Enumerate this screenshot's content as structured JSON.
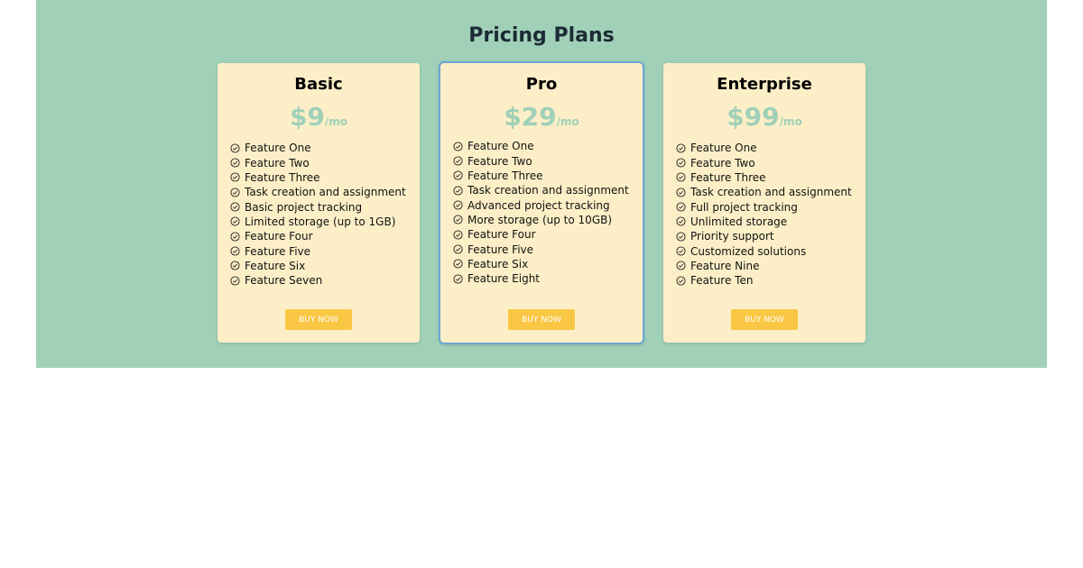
{
  "title": "Pricing Plans",
  "colors": {
    "section_bg": "#a1d0b8",
    "card_bg": "#fcefc7",
    "price": "#a1d0b8",
    "button": "#f9c744",
    "featured_border": "#6aa6d6",
    "title": "#1c2b35"
  },
  "plans": [
    {
      "name": "Basic",
      "price": "$9",
      "period": "/mo",
      "button": "BUY NOW",
      "features": [
        "Feature One",
        "Feature Two",
        "Feature Three",
        "Task creation and assignment",
        "Basic project tracking",
        "Limited storage (up to 1GB)",
        "Feature Four",
        "Feature Five",
        "Feature Six",
        "Feature Seven"
      ]
    },
    {
      "name": "Pro",
      "price": "$29",
      "period": "/mo",
      "button": "BUY NOW",
      "featured": true,
      "features": [
        "Feature One",
        "Feature Two",
        "Feature Three",
        "Task creation and assignment",
        "Advanced project tracking",
        "More storage (up to 10GB)",
        "Feature Four",
        "Feature Five",
        "Feature Six",
        "Feature Eight"
      ]
    },
    {
      "name": "Enterprise",
      "price": "$99",
      "period": "/mo",
      "button": "BUY NOW",
      "features": [
        "Feature One",
        "Feature Two",
        "Feature Three",
        "Task creation and assignment",
        "Full project tracking",
        "Unlimited storage",
        "Priority support",
        "Customized solutions",
        "Feature Nine",
        "Feature Ten"
      ]
    }
  ],
  "icons": {
    "feature_check": "check-circle-icon"
  }
}
